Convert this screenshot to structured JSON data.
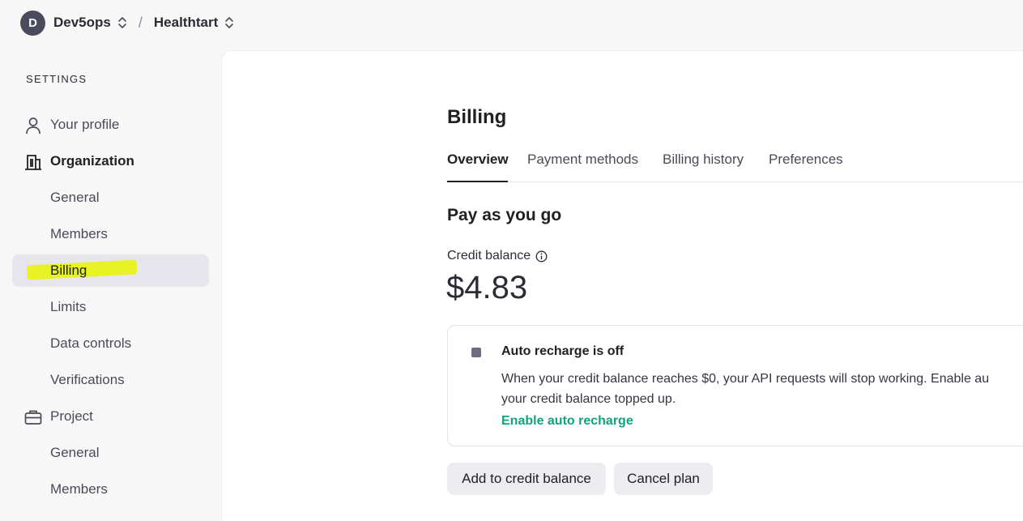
{
  "topbar": {
    "avatar_letter": "D",
    "org_name": "Dev5ops",
    "separator": "/",
    "project_name": "Healthtart"
  },
  "sidebar": {
    "heading": "SETTINGS",
    "items": [
      {
        "label": "Your profile",
        "icon": "person-icon"
      },
      {
        "label": "Organization",
        "icon": "building-icon"
      },
      {
        "label": "General"
      },
      {
        "label": "Members"
      },
      {
        "label": "Billing",
        "active": true
      },
      {
        "label": "Limits"
      },
      {
        "label": "Data controls"
      },
      {
        "label": "Verifications"
      },
      {
        "label": "Project",
        "icon": "briefcase-icon"
      },
      {
        "label": "General"
      },
      {
        "label": "Members"
      }
    ]
  },
  "main": {
    "title": "Billing",
    "tabs": [
      {
        "label": "Overview",
        "active": true
      },
      {
        "label": "Payment methods"
      },
      {
        "label": "Billing history"
      },
      {
        "label": "Preferences"
      }
    ],
    "section_title": "Pay as you go",
    "credit_label": "Credit balance",
    "credit_amount": "$4.83",
    "notice": {
      "title": "Auto recharge is off",
      "body_line1": "When your credit balance reaches $0, your API requests will stop working. Enable au",
      "body_line2": "your credit balance topped up.",
      "link": "Enable auto recharge"
    },
    "buttons": {
      "add_credit": "Add to credit balance",
      "cancel_plan": "Cancel plan"
    }
  },
  "colors": {
    "accent_link": "#10a37f",
    "highlight": "#e9f21a",
    "active_nav_bg": "#e6e6ec"
  }
}
